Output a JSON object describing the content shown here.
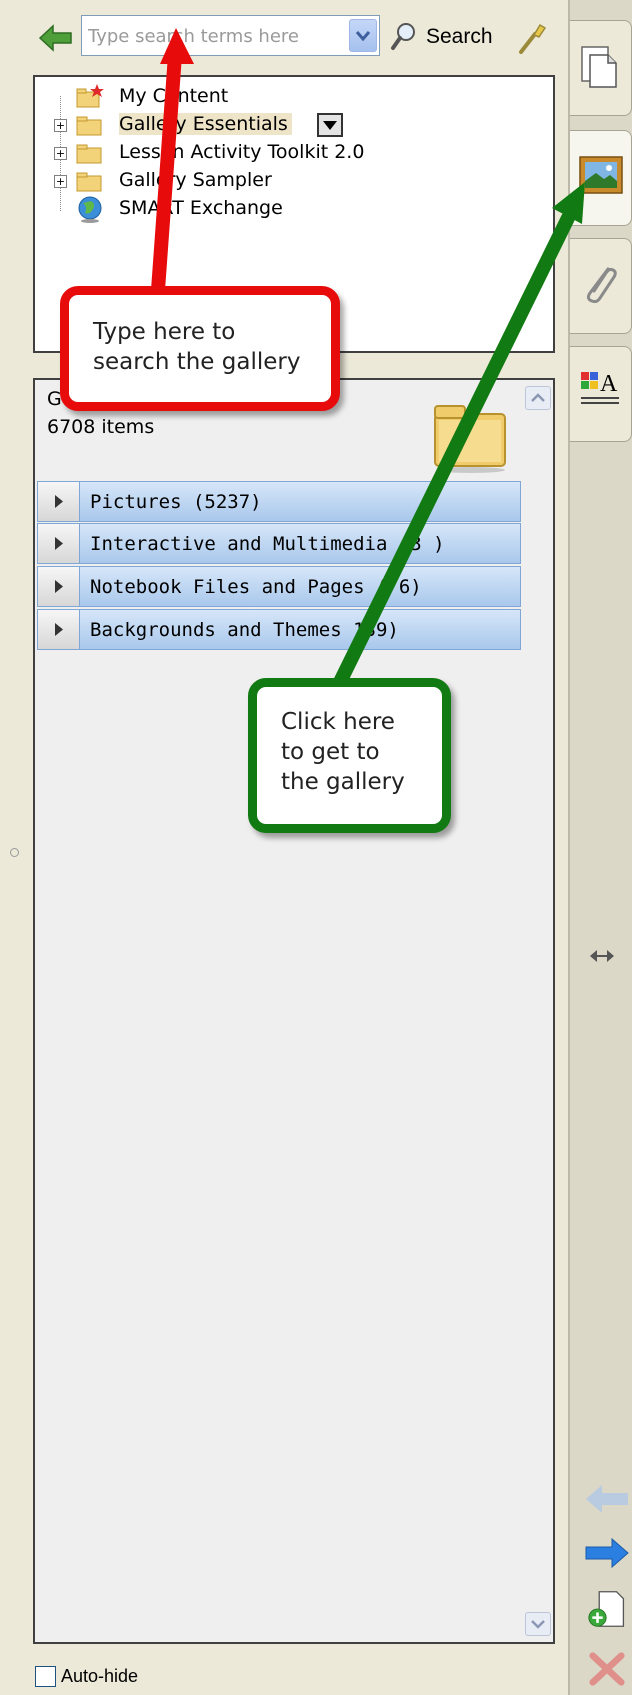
{
  "toolbar": {
    "search_placeholder": "Type search terms here",
    "search_label": "Search"
  },
  "tree": {
    "items": [
      {
        "label": "My Content",
        "icon": "star-folder-icon",
        "expandable": false
      },
      {
        "label": "Gallery Essentials",
        "icon": "folder-icon",
        "expandable": true,
        "selected": true
      },
      {
        "label": "Lesson Activity Toolkit 2.0",
        "icon": "folder-icon",
        "expandable": true
      },
      {
        "label": "Gallery Sampler",
        "icon": "folder-icon",
        "expandable": true
      },
      {
        "label": "SMART Exchange",
        "icon": "globe-icon",
        "expandable": false
      }
    ],
    "expander_symbol": "+"
  },
  "gallery": {
    "header_label": "G",
    "count": "6708 items",
    "categories": [
      {
        "label": "Pictures (5237)"
      },
      {
        "label": "Interactive and Multimedia (3  )"
      },
      {
        "label": "Notebook Files and Pages (  6)"
      },
      {
        "label": "Backgrounds and Themes  139)"
      }
    ]
  },
  "autohide": {
    "label": "Auto-hide",
    "checked": false
  },
  "side_tabs": [
    {
      "icon": "page-sorter-icon",
      "active": false
    },
    {
      "icon": "gallery-icon",
      "active": true
    },
    {
      "icon": "attachments-icon",
      "active": false
    },
    {
      "icon": "properties-icon",
      "active": false
    }
  ],
  "nav": {
    "icons": [
      "back-arrow-icon",
      "forward-arrow-icon",
      "add-page-icon",
      "delete-icon"
    ]
  },
  "callouts": {
    "search": {
      "lines": [
        "Type here to",
        "search the gallery"
      ],
      "color": "#e80b0b"
    },
    "gallery": {
      "lines": [
        "Click here",
        "to get to",
        "the gallery"
      ],
      "color": "#127a12"
    }
  },
  "colors": {
    "panel_bg": "#ece9d8",
    "category_blue": "#a9c8ec",
    "red_accent": "#e80b0b",
    "green_accent": "#127a12"
  }
}
